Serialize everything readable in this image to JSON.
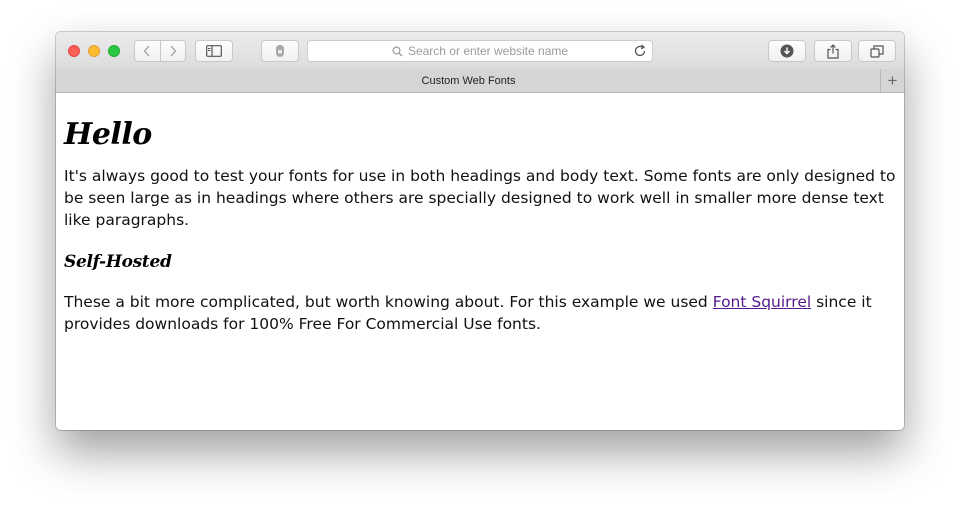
{
  "browser": {
    "address_placeholder": "Search or enter website name",
    "tab_title": "Custom Web Fonts",
    "new_tab_symbol": "+"
  },
  "page": {
    "heading": "Hello",
    "paragraph1": "It's always good to test your fonts for use in both headings and body text. Some fonts are only designed to be seen large as in headings where others are specially designed to work well in smaller more dense text like paragraphs.",
    "subheading": "Self-Hosted",
    "paragraph2_before": "These a bit more complicated, but worth knowing about. For this example we used ",
    "paragraph2_link": "Font Squirrel",
    "paragraph2_after": " since it provides downloads for 100% Free For Commercial Use fonts."
  },
  "icons": {
    "back": "chevron-left-icon",
    "forward": "chevron-right-icon",
    "sidebar": "sidebar-icon",
    "privacy": "privacy-shield-icon",
    "search": "search-icon",
    "reload": "reload-icon",
    "downloads": "download-icon",
    "share": "share-icon",
    "tabs": "tab-overview-icon"
  },
  "colors": {
    "link_visited": "#551a8b",
    "traffic_close": "#fc5f57",
    "traffic_minimize": "#fdbc2e",
    "traffic_zoom": "#28c840"
  }
}
